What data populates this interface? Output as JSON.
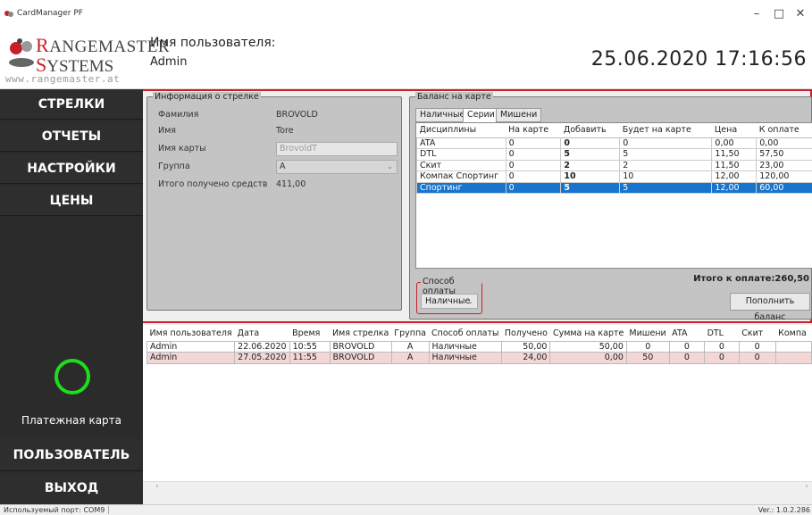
{
  "window": {
    "title": "CardManager PF",
    "minimize": "–",
    "maximize": "□",
    "close": "✕"
  },
  "logo": {
    "word1_cap": "R",
    "word1_rest": "ANGEMASTER",
    "word2_cap": "S",
    "word2_rest": "YSTEMS",
    "site": "www.rangemaster.at"
  },
  "header": {
    "user_label": "Имя пользователя:",
    "user_name": "Admin",
    "datetime": "25.06.2020  17:16:56"
  },
  "sidebar": {
    "items": [
      "СТРЕЛКИ",
      "ОТЧЕТЫ",
      "НАСТРОЙКИ",
      "ЦЕНЫ"
    ],
    "card_label": "Платежная карта",
    "user_button": "ПОЛЬЗОВАТЕЛЬ",
    "exit_button": "ВЫХОД"
  },
  "shooter": {
    "legend": "Информация о стрелке",
    "surname_label": "Фамилия",
    "surname_value": "BROVOLD",
    "name_label": "Имя",
    "name_value": "Tore",
    "card_label": "Имя карты",
    "card_value": "BrovoldT",
    "group_label": "Группа",
    "group_value": "A",
    "total_label": "Итого получено средств",
    "total_value": "411,00"
  },
  "balance": {
    "legend": "Баланс на карте",
    "tabs": [
      "Наличные",
      "Серии",
      "Мишени"
    ],
    "columns": [
      "Дисциплины",
      "На карте",
      "Добавить",
      "Будет на карте",
      "Цена",
      "К оплате"
    ],
    "rows": [
      [
        "ATA",
        "0",
        "0",
        "0",
        "0,00",
        "0,00"
      ],
      [
        "DTL",
        "0",
        "5",
        "5",
        "11,50",
        "57,50"
      ],
      [
        "Скит",
        "0",
        "2",
        "2",
        "11,50",
        "23,00"
      ],
      [
        "Компак Спортинг",
        "0",
        "10",
        "10",
        "12,00",
        "120,00"
      ],
      [
        "Спортинг",
        "0",
        "5",
        "5",
        "12,00",
        "60,00"
      ]
    ],
    "total": "Итого к оплате:260,50",
    "payment_legend": "Способ оплаты",
    "payment_value": "Наличные",
    "topup_button": "Пополнить баланс"
  },
  "history": {
    "columns": [
      "Имя пользователя",
      "Дата",
      "Время",
      "Имя стрелка",
      "Группа",
      "Способ оплаты",
      "Получено",
      "Сумма на карте",
      "Мишени",
      "ATA",
      "DTL",
      "Скит",
      "Компа"
    ],
    "rows": [
      [
        "Admin",
        "22.06.2020",
        "10:55",
        "BROVOLD",
        "A",
        "Наличные",
        "50,00",
        "50,00",
        "0",
        "0",
        "0",
        "0",
        ""
      ],
      [
        "Admin",
        "27.05.2020",
        "11:55",
        "BROVOLD",
        "A",
        "Наличные",
        "24,00",
        "0,00",
        "50",
        "0",
        "0",
        "0",
        ""
      ]
    ]
  },
  "status": {
    "port": "Используемый порт: COM9",
    "version": "Ver.: 1.0.2.286"
  },
  "colors": {
    "accent_red": "#c8202a",
    "selection_blue": "#1874cd",
    "card_ring_green": "#1dde1d",
    "sidebar_bg": "#2b2b2b"
  }
}
